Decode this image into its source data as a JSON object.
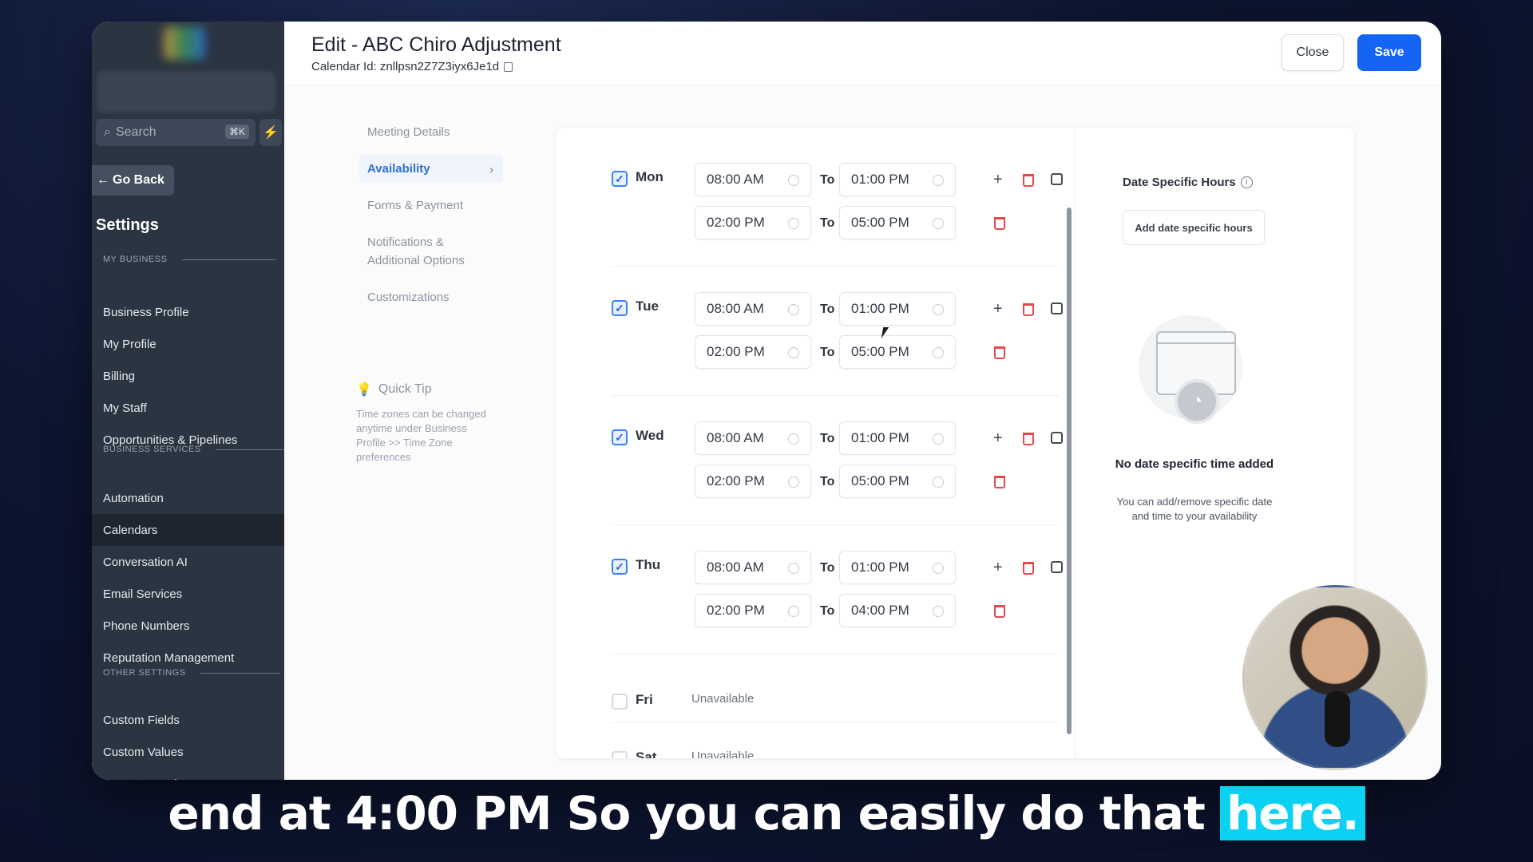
{
  "sidebar": {
    "search_placeholder": "Search",
    "search_shortcut": "⌘K",
    "back_label": "Go Back",
    "title": "Settings",
    "sections": {
      "my_business": "MY BUSINESS",
      "business_services": "BUSINESS SERVICES",
      "other_settings": "OTHER SETTINGS"
    },
    "items": [
      "Business Profile",
      "My Profile",
      "Billing",
      "My Staff",
      "Opportunities & Pipelines",
      "Automation",
      "Calendars",
      "Conversation AI",
      "Email Services",
      "Phone Numbers",
      "Reputation Management",
      "Custom Fields",
      "Custom Values",
      "Manage Scoring"
    ],
    "active_item": "Calendars"
  },
  "header": {
    "title": "Edit - ABC Chiro Adjustment",
    "calendar_id": "Calendar Id: znllpsn2Z7Z3iyx6Je1d",
    "close_label": "Close",
    "save_label": "Save"
  },
  "left_nav": {
    "items": [
      "Meeting Details",
      "Availability",
      "Forms & Payment",
      "Notifications & Additional Options",
      "Customizations"
    ],
    "active": "Availability"
  },
  "tip": {
    "title": "Quick Tip",
    "body": "Time zones can be changed anytime under Business Profile >> Time Zone preferences"
  },
  "availability": {
    "to_label": "To",
    "unavailable_label": "Unavailable",
    "days": [
      {
        "name": "Mon",
        "checked": true,
        "slots": [
          [
            "08:00 AM",
            "01:00 PM"
          ],
          [
            "02:00 PM",
            "05:00 PM"
          ]
        ]
      },
      {
        "name": "Tue",
        "checked": true,
        "slots": [
          [
            "08:00 AM",
            "01:00 PM"
          ],
          [
            "02:00 PM",
            "05:00 PM"
          ]
        ]
      },
      {
        "name": "Wed",
        "checked": true,
        "slots": [
          [
            "08:00 AM",
            "01:00 PM"
          ],
          [
            "02:00 PM",
            "05:00 PM"
          ]
        ]
      },
      {
        "name": "Thu",
        "checked": true,
        "slots": [
          [
            "08:00 AM",
            "01:00 PM"
          ],
          [
            "02:00 PM",
            "04:00 PM"
          ]
        ]
      },
      {
        "name": "Fri",
        "checked": false,
        "slots": []
      },
      {
        "name": "Sat",
        "checked": false,
        "slots": []
      }
    ]
  },
  "date_specific": {
    "title": "Date Specific Hours",
    "add_label": "Add date specific hours",
    "empty_title": "No date specific time added",
    "empty_sub": "You can add/remove specific date and time to your availability"
  },
  "caption": {
    "text": "end at 4:00 PM So you can easily do that",
    "highlight": "here."
  },
  "colors": {
    "accent": "#1565f5",
    "sidebar_bg": "#2b3441",
    "delete": "#e5484d",
    "caption_highlight": "#0bd1f2"
  }
}
